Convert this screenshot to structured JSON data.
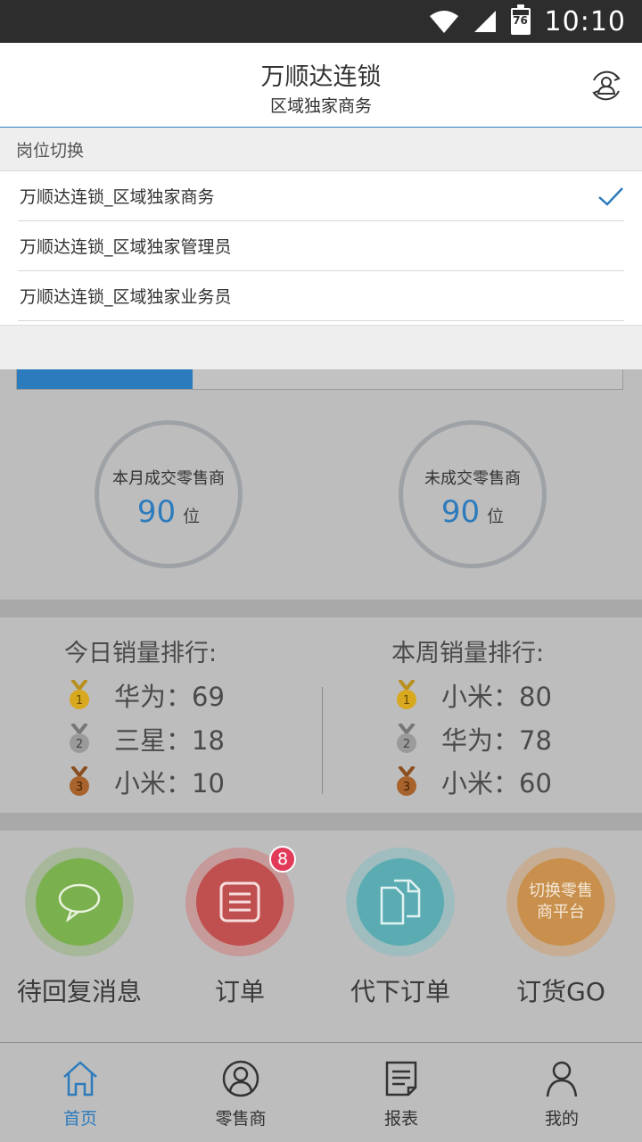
{
  "status_bar": {
    "time": "10:10",
    "battery": "76"
  },
  "header": {
    "title": "万顺达连锁",
    "subtitle": "区域独家商务"
  },
  "dropdown": {
    "title": "岗位切换",
    "items": [
      {
        "label": "万顺达连锁_区域独家商务",
        "selected": true
      },
      {
        "label": "万顺达连锁_区域独家管理员",
        "selected": false
      },
      {
        "label": "万顺达连锁_区域独家业务员",
        "selected": false
      }
    ]
  },
  "progress": {
    "fraction": 0.29
  },
  "stats": {
    "month_deal": {
      "label": "本月成交零售商",
      "value": "90",
      "unit": "位"
    },
    "no_deal": {
      "label": "未成交零售商",
      "value": "90",
      "unit": "位"
    }
  },
  "ranking": {
    "today": {
      "title": "今日销量排行:",
      "rows": [
        {
          "rank": "1",
          "text": "华为：69"
        },
        {
          "rank": "2",
          "text": "三星：18"
        },
        {
          "rank": "3",
          "text": "小米：10"
        }
      ]
    },
    "week": {
      "title": "本周销量排行:",
      "rows": [
        {
          "rank": "1",
          "text": "小米：80"
        },
        {
          "rank": "2",
          "text": "华为：78"
        },
        {
          "rank": "3",
          "text": "小米：60"
        }
      ]
    }
  },
  "actions": {
    "messages": {
      "label": "待回复消息"
    },
    "orders": {
      "label": "订单",
      "badge": "8"
    },
    "proxy_order": {
      "label": "代下订单"
    },
    "go": {
      "label": "订货GO",
      "core_line1": "切换零售",
      "core_line2": "商平台"
    }
  },
  "nav": {
    "home": "首页",
    "retailers": "零售商",
    "reports": "报表",
    "mine": "我的"
  },
  "colors": {
    "accent": "#2c7bbd",
    "green": "#7bb04f",
    "red": "#c0504f",
    "teal": "#5aacb2",
    "orange": "#c8904c",
    "badge": "#e23b5a"
  }
}
